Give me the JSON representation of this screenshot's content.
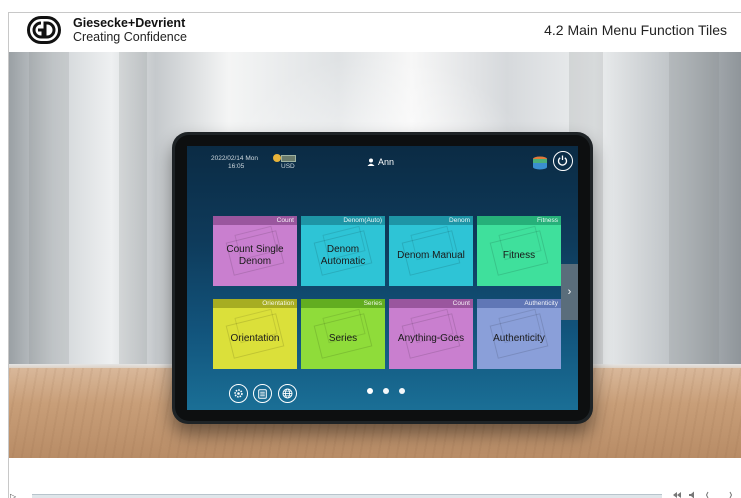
{
  "header": {
    "brand_name": "Giesecke+Devrient",
    "brand_tagline": "Creating Confidence",
    "slide_title": "4.2 Main Menu Function Tiles"
  },
  "device": {
    "status": {
      "date": "2022/02/14 Mon",
      "time": "16:05",
      "currency": "USD",
      "user": "Ann"
    },
    "tiles": [
      {
        "tag": "Count",
        "label": "Count Single Denom",
        "color": "#c97fcf",
        "tag_color": "#9a569e"
      },
      {
        "tag": "Denom(Auto)",
        "label": "Denom Automatic",
        "color": "#2ec4d6",
        "tag_color": "#1e95a6"
      },
      {
        "tag": "Denom",
        "label": "Denom Manual",
        "color": "#2ec4d6",
        "tag_color": "#1e95a6"
      },
      {
        "tag": "Fitness",
        "label": "Fitness",
        "color": "#3fe09c",
        "tag_color": "#26b079"
      },
      {
        "tag": "Orientation",
        "label": "Orientation",
        "color": "#dbe03a",
        "tag_color": "#a7ad22"
      },
      {
        "tag": "Series",
        "label": "Series",
        "color": "#8fdc3a",
        "tag_color": "#62ad20"
      },
      {
        "tag": "Count",
        "label": "Anything-Goes",
        "color": "#c97fcf",
        "tag_color": "#9a569e"
      },
      {
        "tag": "Authenticity",
        "label": "Authenticity",
        "color": "#8a9fd9",
        "tag_color": "#6077b6"
      }
    ],
    "next_arrow": "›",
    "page_dots": 3,
    "active_page": 1
  },
  "player": {
    "play_glyph": "▷"
  }
}
